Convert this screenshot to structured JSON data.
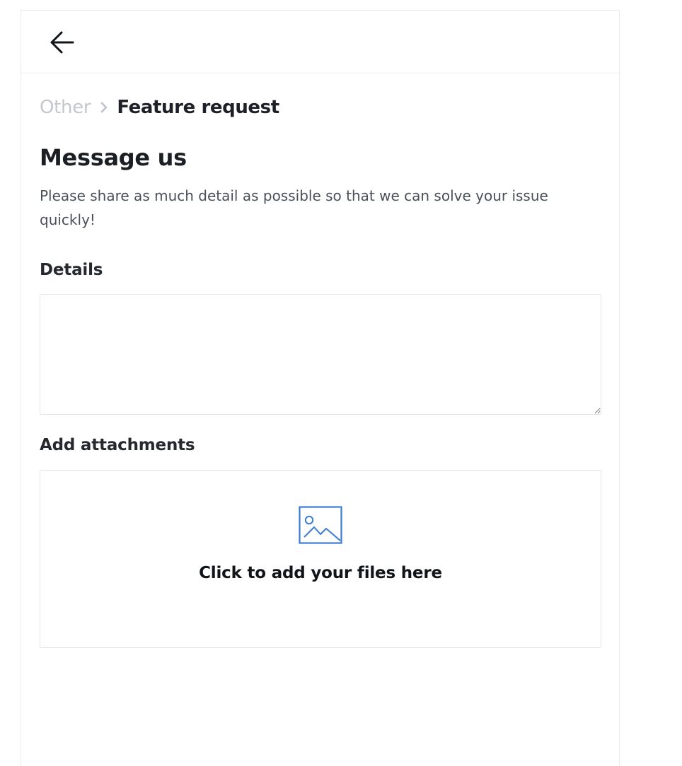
{
  "header": {
    "back_icon": "arrow-left-icon"
  },
  "breadcrumb": {
    "parent": "Other",
    "separator_icon": "chevron-right-icon",
    "current": "Feature request"
  },
  "page": {
    "title": "Message us",
    "description": "Please share as much detail as possible so that we can solve your issue quickly!"
  },
  "details": {
    "label": "Details",
    "value": "",
    "placeholder": ""
  },
  "attachments": {
    "label": "Add attachments",
    "icon": "image-icon",
    "prompt": "Click to add your files here"
  },
  "colors": {
    "accent": "#3a7bd5",
    "breadcrumb_parent": "#c4c7cd",
    "border": "#e3e5e8",
    "text": "#1b1f24",
    "muted_text": "#4b5058"
  }
}
